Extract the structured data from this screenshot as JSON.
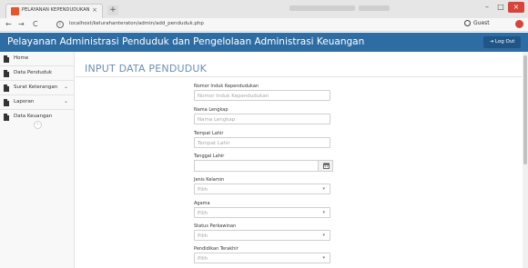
{
  "browser": {
    "tab_title": "PELAYANAN KEPENDUDUKAN",
    "tab_close": "×",
    "new_tab": "+",
    "url": "localhost/kelurahanteraton/admin/add_penduduk.php",
    "profile_label": "Guest",
    "nav": {
      "back": "←",
      "forward": "→",
      "reload": "C",
      "info": "i"
    },
    "window_buttons": {
      "minimize": "–",
      "maximize": "□",
      "close": "×"
    }
  },
  "header": {
    "title": "Pelayanan Administrasi Penduduk dan Pengelolaan Administrasi Keuangan",
    "logout_label": "Log Out",
    "logout_icon": "⇥"
  },
  "sidebar": {
    "items": [
      {
        "label": "Home",
        "has_dropdown": false
      },
      {
        "label": "Data Penduduk",
        "has_dropdown": false
      },
      {
        "label": "Surat Keterangan",
        "has_dropdown": true
      },
      {
        "label": "Laporan",
        "has_dropdown": true
      },
      {
        "label": "Data Keuangan",
        "has_dropdown": false
      }
    ],
    "collapse_glyph": "‹"
  },
  "page": {
    "title": "INPUT DATA PENDUDUK"
  },
  "form": {
    "nik": {
      "label": "Nomor Induk Kependudukan",
      "placeholder": "Nomor Induk Kependudukan"
    },
    "nama": {
      "label": "Nama Lengkap",
      "placeholder": "Nama Lengkap"
    },
    "tempat_lahir": {
      "label": "Tempat Lahir",
      "placeholder": "Tempat Lahir"
    },
    "tanggal_lahir": {
      "label": "Tanggal Lahir",
      "value": ""
    },
    "jenis_kelamin": {
      "label": "Jenis Kelamin",
      "selected": "Pilih"
    },
    "agama": {
      "label": "Agama",
      "selected": "Pilih"
    },
    "status_perkawinan": {
      "label": "Status Perkawinan",
      "selected": "Pilih"
    },
    "pendidikan": {
      "label": "Pendidikan Terakhir",
      "selected": "Pilih"
    }
  },
  "colors": {
    "header_bg": "#2e6da4",
    "page_title": "#6a8fb2",
    "favicon": "#e8542a"
  },
  "icons": {
    "sidebar_item": "document-icon",
    "dropdown": "chevron-down-icon",
    "date": "calendar-icon"
  }
}
